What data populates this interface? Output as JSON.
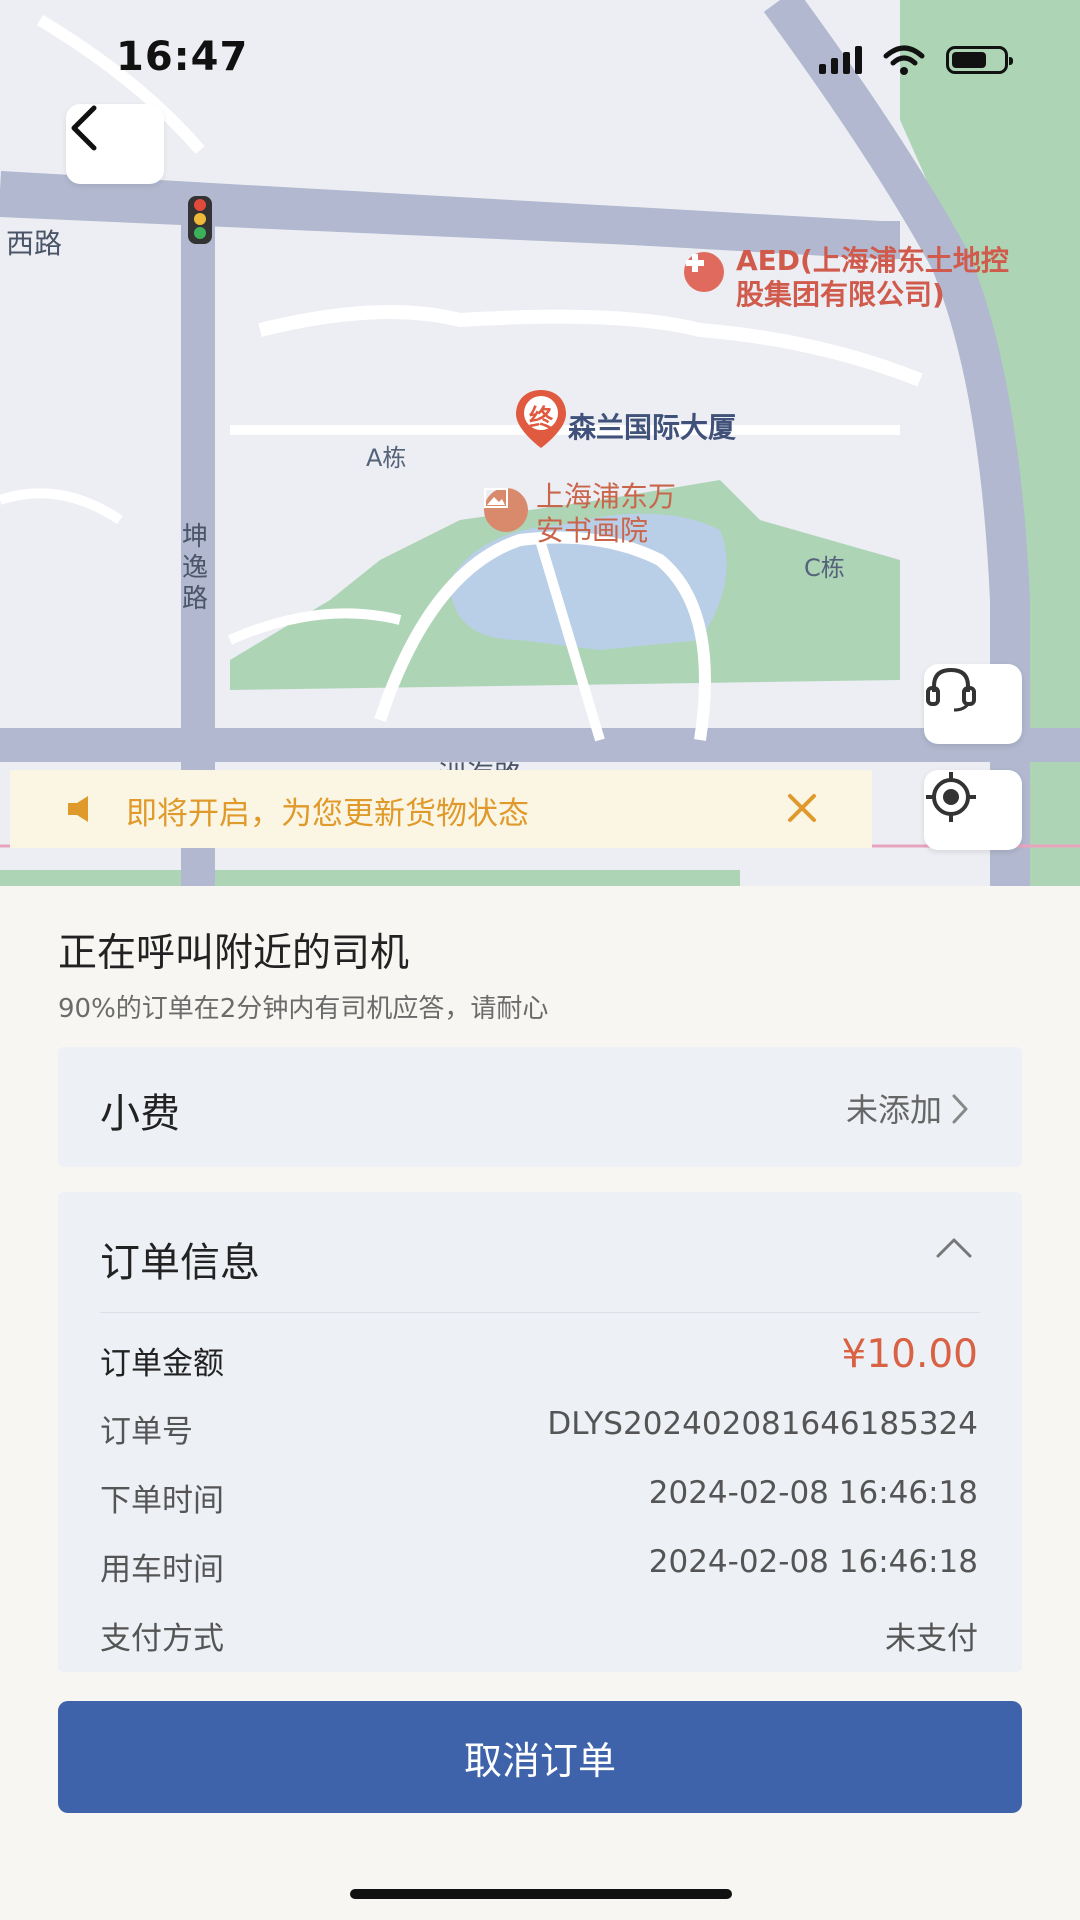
{
  "status_bar": {
    "time": "16:47"
  },
  "map": {
    "road_west": "西路",
    "road_vertical": "坤逸路",
    "road_bottom": "洲海路",
    "building_a": "A栋",
    "building_c": "C栋",
    "aed_poi": "AED(上海浦东土地控股集团有限公司)",
    "destination_marker": "终",
    "destination_name": "森兰国际大厦",
    "gallery_poi": "上海浦东万安书画院"
  },
  "notice": {
    "text": "即将开启，为您更新货物状态"
  },
  "order_status": {
    "title": "正在呼叫附近的司机",
    "subtitle": "90%的订单在2分钟内有司机应答，请耐心"
  },
  "tip": {
    "label": "小费",
    "value": "未添加"
  },
  "order_info": {
    "title": "订单信息",
    "rows": [
      {
        "label": "订单金额",
        "value": "¥10.00"
      },
      {
        "label": "订单号",
        "value": "DLYS20240208164618532​4"
      },
      {
        "label": "下单时间",
        "value": "2024-02-08 16:46:18"
      },
      {
        "label": "用车时间",
        "value": "2024-02-08 16:46:18"
      },
      {
        "label": "支付方式",
        "value": "未支付"
      }
    ]
  },
  "actions": {
    "cancel_label": "取消订单"
  },
  "colors": {
    "accent": "#3f63aa",
    "amount": "#d96244",
    "notice": "#e09a2b"
  }
}
